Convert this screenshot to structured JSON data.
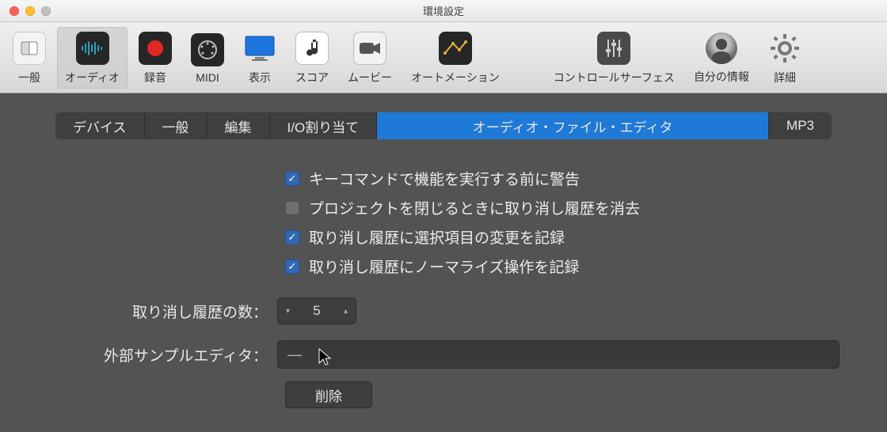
{
  "window": {
    "title": "環境設定"
  },
  "toolbar": {
    "items": [
      {
        "label": "一般"
      },
      {
        "label": "オーディオ",
        "selected": true
      },
      {
        "label": "録音"
      },
      {
        "label": "MIDI"
      },
      {
        "label": "表示"
      },
      {
        "label": "スコア"
      },
      {
        "label": "ムービー"
      },
      {
        "label": "オートメーション"
      },
      {
        "label": "コントロールサーフェス"
      },
      {
        "label": "自分の情報"
      },
      {
        "label": "詳細"
      }
    ]
  },
  "tabs": {
    "items": [
      {
        "label": "デバイス"
      },
      {
        "label": "一般"
      },
      {
        "label": "編集"
      },
      {
        "label": "I/O割り当て"
      },
      {
        "label": "オーディオ・ファイル・エディタ",
        "selected": true
      },
      {
        "label": "MP3"
      }
    ]
  },
  "checkboxes": {
    "warn_before_key_command": {
      "label": "キーコマンドで機能を実行する前に警告",
      "checked": true
    },
    "clear_undo_on_close": {
      "label": "プロジェクトを閉じるときに取り消し履歴を消去",
      "checked": false
    },
    "record_selection_undo": {
      "label": "取り消し履歴に選択項目の変更を記録",
      "checked": true
    },
    "record_normalize_undo": {
      "label": "取り消し履歴にノーマライズ操作を記録",
      "checked": true
    }
  },
  "undo_steps": {
    "label": "取り消し履歴の数：",
    "value": "5"
  },
  "external_editor": {
    "label": "外部サンプルエディタ：",
    "value": "—"
  },
  "delete_button": {
    "label": "削除"
  }
}
